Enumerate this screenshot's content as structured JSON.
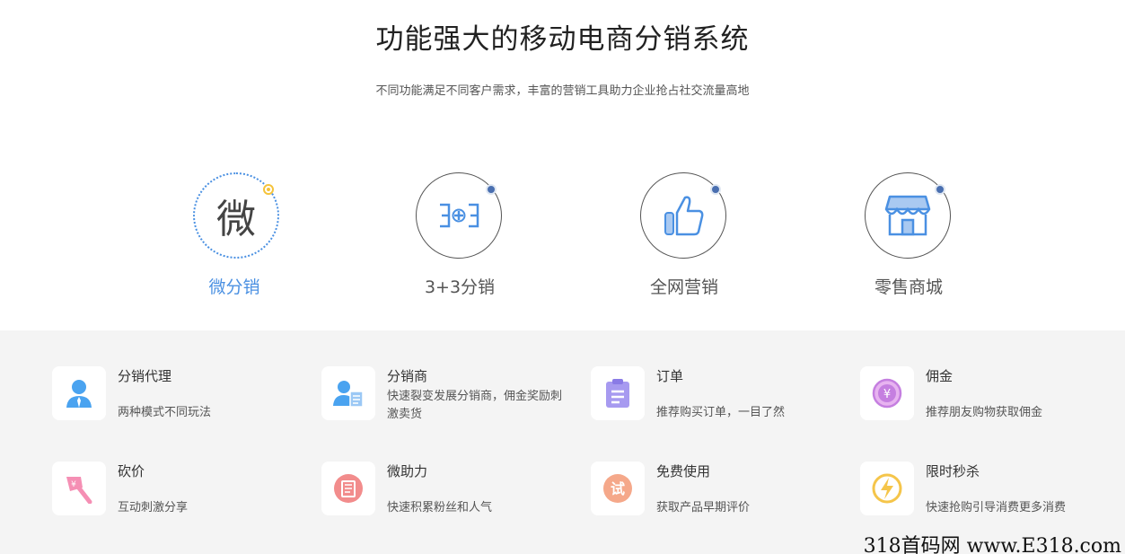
{
  "header": {
    "title": "功能强大的移动电商分销系统",
    "subtitle": "不同功能满足不同客户需求，丰富的营销工具助力企业抢占社交流量高地"
  },
  "tabs": [
    {
      "label": "微分销",
      "glyph": "微",
      "icon": "wei-character-icon",
      "active": true
    },
    {
      "label": "3+3分销",
      "icon": "three-plus-three-icon",
      "active": false
    },
    {
      "label": "全网营销",
      "icon": "thumbs-up-icon",
      "active": false
    },
    {
      "label": "零售商城",
      "icon": "storefront-icon",
      "active": false
    }
  ],
  "features": [
    {
      "name": "分销代理",
      "desc": "两种模式不同玩法",
      "icon": "agent-person-icon"
    },
    {
      "name": "分销商",
      "desc": "快速裂变发展分销商，佣金奖励刺激卖货",
      "icon": "distributor-icon"
    },
    {
      "name": "订单",
      "desc": "推荐购买订单，一目了然",
      "icon": "clipboard-icon"
    },
    {
      "name": "佣金",
      "desc": "推荐朋友购物获取佣金",
      "icon": "yen-coin-icon"
    },
    {
      "name": "砍价",
      "desc": "互动刺激分享",
      "icon": "axe-icon"
    },
    {
      "name": "微助力",
      "desc": "快速积累粉丝和人气",
      "icon": "booklet-icon"
    },
    {
      "name": "免费使用",
      "desc": "获取产品早期评价",
      "icon": "trial-icon",
      "glyph": "试"
    },
    {
      "name": "限时秒杀",
      "desc": "快速抢购引导消费更多消费",
      "icon": "lightning-icon"
    }
  ],
  "watermark": "318首码网 www.E318.com",
  "colors": {
    "accent": "#4a90e2",
    "section_bg": "#f4f4f4"
  }
}
